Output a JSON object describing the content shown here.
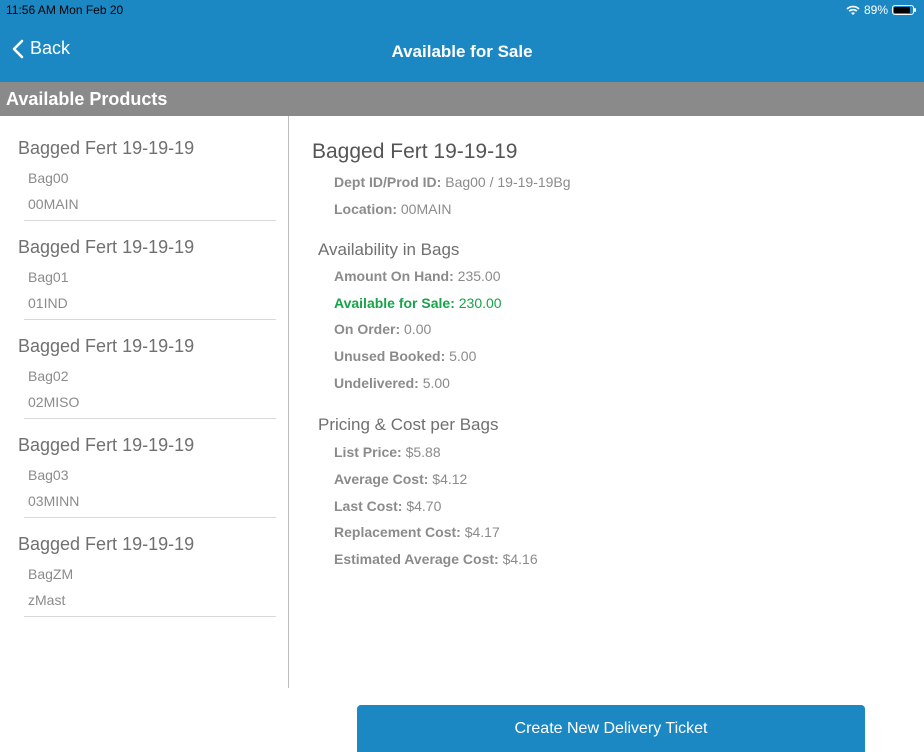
{
  "status_bar": {
    "time": "11:56 AM  Mon Feb 20",
    "battery": "89%"
  },
  "nav": {
    "back_label": "Back",
    "title": "Available for Sale"
  },
  "section_header": "Available Products",
  "products": [
    {
      "title": "Bagged Fert 19-19-19",
      "dept": "Bag00",
      "location": "00MAIN"
    },
    {
      "title": "Bagged Fert 19-19-19",
      "dept": "Bag01",
      "location": "01IND"
    },
    {
      "title": "Bagged Fert 19-19-19",
      "dept": "Bag02",
      "location": "02MISO"
    },
    {
      "title": "Bagged Fert 19-19-19",
      "dept": "Bag03",
      "location": "03MINN"
    },
    {
      "title": "Bagged Fert 19-19-19",
      "dept": "BagZM",
      "location": "zMast"
    }
  ],
  "detail": {
    "title": "Bagged Fert 19-19-19",
    "dept_prod_label": "Dept ID/Prod ID:",
    "dept_prod_value": "Bag00 / 19-19-19Bg",
    "location_label": "Location:",
    "location_value": "00MAIN",
    "availability_header": "Availability in Bags",
    "amount_on_hand_label": "Amount On Hand:",
    "amount_on_hand_value": "235.00",
    "available_label": "Available for Sale:",
    "available_value": "230.00",
    "on_order_label": "On Order:",
    "on_order_value": "0.00",
    "unused_booked_label": "Unused Booked:",
    "unused_booked_value": "5.00",
    "undelivered_label": "Undelivered:",
    "undelivered_value": "5.00",
    "pricing_header": "Pricing & Cost per Bags",
    "list_price_label": "List Price:",
    "list_price_value": "$5.88",
    "average_cost_label": "Average Cost:",
    "average_cost_value": "$4.12",
    "last_cost_label": "Last Cost:",
    "last_cost_value": "$4.70",
    "replacement_cost_label": "Replacement Cost:",
    "replacement_cost_value": "$4.17",
    "estimated_average_cost_label": "Estimated Average Cost:",
    "estimated_average_cost_value": "$4.16"
  },
  "create_button_label": "Create New Delivery Ticket",
  "colors": {
    "primary": "#1b88c4",
    "header_gray": "#8a8a8a",
    "available_green": "#17a34a"
  }
}
